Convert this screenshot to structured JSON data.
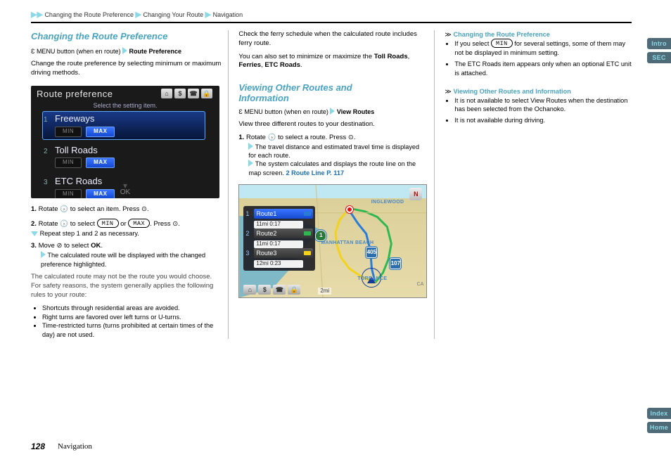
{
  "breadcrumb": {
    "seg1": "Changing the Route Preference",
    "seg2": "Changing Your Route",
    "seg3": "Navigation"
  },
  "section": {
    "title": "Changing the Route Preference",
    "menu_path_prefix": "MENU button (when en route)",
    "menu_path_item": "Route Preference",
    "intro": "Change the route preference by selecting minimum or maximum driving methods.",
    "instr1_no": "1.",
    "instr1": "Rotate",
    "instr1_cont": "to select an item. Press",
    "instr1_end": ".",
    "instr2_no": "2.",
    "instr2a": "Rotate",
    "instr2b": "to select",
    "instr2c": "or",
    "instr2d": ". Press",
    "instr2e": ".",
    "min": "MIN",
    "max": "MAX",
    "repeat_a": "Repeat step 1 and 2 as necessary.",
    "instr3_no": "3.",
    "instr3a": "Move",
    "instr3b": "to select",
    "instr3c": ".",
    "ok": "OK",
    "sub_a": "The calculated route will be displayed with the changed preference highlighted.",
    "noteA_1": "The calculated route may not be the route you would choose. For safety reasons, the system generally applies the following rules to your route:",
    "noteA_bullets": [
      "Shortcuts through residential areas are avoided.",
      "Right turns are favored over left turns or U-turns.",
      "Time-restricted turns (turns prohibited at certain times of the day) are not used."
    ],
    "noteA_2": "Check the ferry schedule when the calculated route includes ferry route.",
    "noteA_3a": "You can also set to minimize or maximize the",
    "noteA_3b": ",",
    "noteA_3c1": "Toll Roads",
    "noteA_3c2": "Ferries",
    "noteA_3c3": "ETC Roads",
    "noteA_3d": "."
  },
  "section2": {
    "heading_line1": "Viewing Other Routes and",
    "heading_line2": "Information",
    "menu_path_prefix": "MENU button (when en route)",
    "menu_path_item": "View Routes",
    "intro": "View three different routes to your destination.",
    "instr1_no": "1.",
    "instr1a": "Rotate",
    "instr1b": "to select a route.",
    "instr1c": "Press",
    "instr1d": ".",
    "sub_a": "The travel distance and estimated travel time is displayed for each route.",
    "sub_b": "The system calculates and displays the route line on the map screen. ",
    "xref_label": "2",
    "xref_text": "Route Line",
    "xref_page": "P. 117"
  },
  "sidenotes": {
    "note1_head": "Changing the Route Preference",
    "note1_b1a": "If you select",
    "note1_b1b": "for several settings, some of them may not be displayed in minimum setting.",
    "minlbl": "MIN",
    "note1_b2": "The ETC Roads item appears only when an optional ETC unit is attached.",
    "note2_head": "Viewing Other Routes and Information",
    "note2_b1": "It is not available to select View Routes when the destination has been selected from the Ochanoko.",
    "note2_b2": "It is not available during driving."
  },
  "shot1": {
    "title": "Route preference",
    "subtitle": "Select the setting item.",
    "rows": [
      {
        "num": "1",
        "label": "Freeways",
        "min": "MIN",
        "max": "MAX"
      },
      {
        "num": "2",
        "label": "Toll Roads",
        "min": "MIN",
        "max": "MAX"
      },
      {
        "num": "3",
        "label": "ETC Roads",
        "min": "MIN",
        "max": "MAX"
      }
    ],
    "ok": "OK",
    "icons": [
      "globe-icon",
      "money-icon",
      "phone-icon",
      "lock-icon"
    ]
  },
  "shot2": {
    "routes": [
      {
        "num": "1",
        "label": "Route1",
        "dist": "11mi  0:17",
        "color": "#2a7bd8",
        "selected": true
      },
      {
        "num": "2",
        "label": "Route2",
        "dist": "11mi  0:17",
        "color": "#2fb851",
        "selected": false
      },
      {
        "num": "3",
        "label": "Route3",
        "dist": "12mi  0:23",
        "color": "#f2d21a",
        "selected": false
      }
    ],
    "cities": {
      "c1": "INGLEWOOD",
      "c2": "MANHATTAN BEACH",
      "c3": "TORRANCE",
      "c4": "CA"
    },
    "shields": {
      "s1": "405",
      "s2": "1",
      "s3": "107"
    },
    "scale": "2mi",
    "north": "N",
    "bottom_icons": [
      "globe-icon",
      "money-icon",
      "phone-icon",
      "lock-icon"
    ]
  },
  "footer": {
    "page": "128",
    "label": "Navigation"
  },
  "tabs": {
    "t1": "Intro",
    "t2": "SEC",
    "t3": "Index",
    "t4": "Home"
  }
}
